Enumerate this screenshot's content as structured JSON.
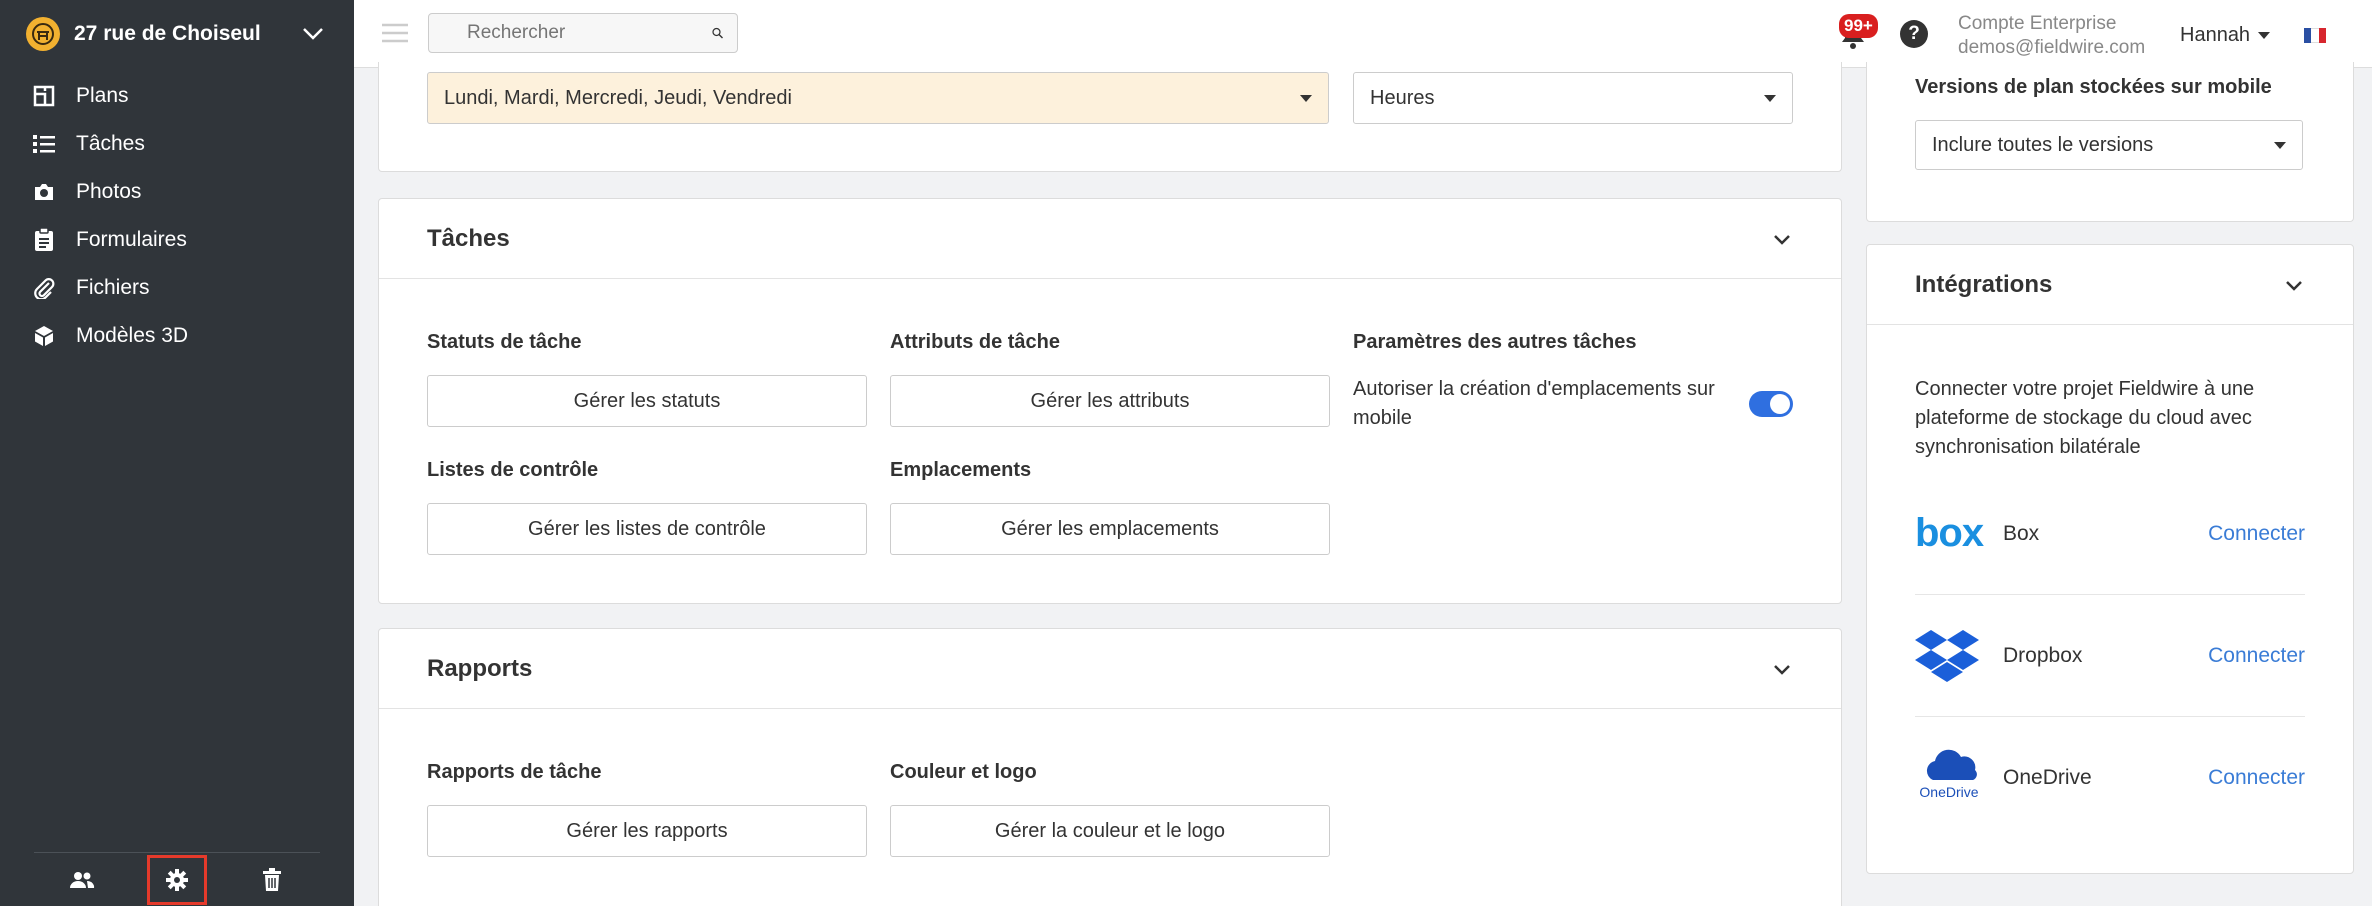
{
  "project": {
    "name": "27 rue de Choiseul"
  },
  "sidebar": {
    "items": [
      {
        "label": "Plans",
        "icon": "plans-icon"
      },
      {
        "label": "Tâches",
        "icon": "list-icon"
      },
      {
        "label": "Photos",
        "icon": "camera-icon"
      },
      {
        "label": "Formulaires",
        "icon": "clipboard-icon"
      },
      {
        "label": "Fichiers",
        "icon": "paperclip-icon"
      },
      {
        "label": "Modèles 3D",
        "icon": "cube-icon"
      }
    ],
    "bottom": [
      "people-icon",
      "gear-icon",
      "trash-icon"
    ]
  },
  "topbar": {
    "search_placeholder": "Rechercher",
    "notif_badge": "99+",
    "help": "?",
    "account_type": "Compte Enterprise",
    "account_email": "demos@fieldwire.com",
    "user": "Hannah"
  },
  "schedule": {
    "days_value": "Lundi, Mardi, Mercredi, Jeudi, Vendredi",
    "unit_value": "Heures"
  },
  "tasks": {
    "title": "Tâches",
    "statuts_label": "Statuts de tâche",
    "statuts_button": "Gérer les statuts",
    "attributs_label": "Attributs de tâche",
    "attributs_button": "Gérer les attributs",
    "autres_label": "Paramètres des autres tâches",
    "autres_toggle_label": "Autoriser la création d'emplacements sur mobile",
    "listes_label": "Listes de contrôle",
    "listes_button": "Gérer les listes de contrôle",
    "emplacements_label": "Emplacements",
    "emplacements_button": "Gérer les emplacements"
  },
  "reports": {
    "title": "Rapports",
    "rapports_label": "Rapports de tâche",
    "rapports_button": "Gérer les rapports",
    "couleur_label": "Couleur et logo",
    "couleur_button": "Gérer la couleur et le logo"
  },
  "mobile": {
    "label": "Versions de plan stockées sur mobile",
    "value": "Inclure toutes le versions"
  },
  "integrations": {
    "title": "Intégrations",
    "description": "Connecter votre projet Fieldwire à une plateforme de stockage du cloud avec synchronisation bilatérale",
    "items": [
      {
        "name": "Box",
        "action": "Connecter"
      },
      {
        "name": "Dropbox",
        "action": "Connecter"
      },
      {
        "name": "OneDrive",
        "action": "Connecter"
      }
    ],
    "onedrive_logo_text": "OneDrive",
    "box_logo_text": "box"
  },
  "colors": {
    "sidebar": "#30353a",
    "accent": "#2f6fe0",
    "link": "#3a7cd6",
    "highlight": "#fdf1dc",
    "badge": "#d91f1f"
  }
}
